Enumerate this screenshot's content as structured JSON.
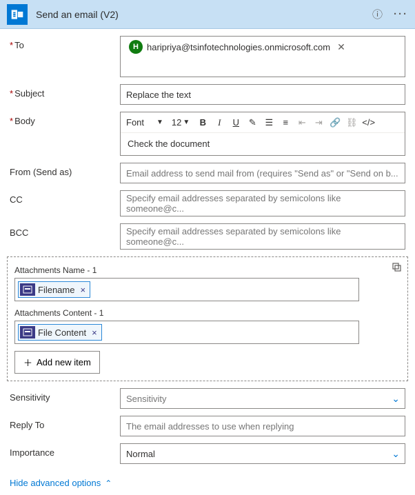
{
  "header": {
    "title": "Send an email (V2)"
  },
  "to": {
    "label": "To",
    "chip_initial": "H",
    "chip_email": "haripriya@tsinfotechnologies.onmicrosoft.com"
  },
  "subject": {
    "label": "Subject",
    "value": "Replace the text"
  },
  "body": {
    "label": "Body",
    "font": "Font",
    "size": "12",
    "value": "Check the document"
  },
  "from": {
    "label": "From (Send as)",
    "placeholder": "Email address to send mail from (requires \"Send as\" or \"Send on b..."
  },
  "cc": {
    "label": "CC",
    "placeholder": "Specify email addresses separated by semicolons like someone@c..."
  },
  "bcc": {
    "label": "BCC",
    "placeholder": "Specify email addresses separated by semicolons like someone@c..."
  },
  "attachments": {
    "name_label": "Attachments Name - 1",
    "name_token": "Filename",
    "content_label": "Attachments Content - 1",
    "content_token": "File Content",
    "add_label": "Add new item"
  },
  "sensitivity": {
    "label": "Sensitivity",
    "placeholder": "Sensitivity"
  },
  "reply_to": {
    "label": "Reply To",
    "placeholder": "The email addresses to use when replying"
  },
  "importance": {
    "label": "Importance",
    "value": "Normal"
  },
  "hide_link": "Hide advanced options"
}
